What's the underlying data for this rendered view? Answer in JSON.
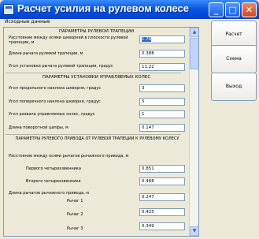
{
  "window": {
    "title": "Расчет усилия на рулевом колесе",
    "controls": {
      "minimize": "_",
      "maximize": "□",
      "close": "✕"
    }
  },
  "menu": {
    "item": "Исходные данные"
  },
  "sections": {
    "s1_title": "ПАРАМЕТРЫ РУЛЕВОЙ ТРАПЕЦИИ",
    "s2_title": "ПАРАМЕТРЫ УСТАНОВКИ УПРАВЛЯЕМЫХ КОЛЕС",
    "s3_title": "ПАРАМЕТРЫ РУЛЕВОГО ПРИВОДА ОТ РУЛЕВОЙ ТРАПЕЦИИ К РУЛЕВОМУ КОЛЕСУ"
  },
  "trapezoid": {
    "kingpin_distance_label": "Расстояние между осями шкворней в плоскости рулевой трапеции, м",
    "kingpin_distance_value": "1.78",
    "lever_length_label": "Длина рычага рулевой трапеции, м",
    "lever_length_value": "0.388",
    "lever_angle_label": "Угол установки рычага рулевой трапеции, градус",
    "lever_angle_value": "11.22"
  },
  "wheels": {
    "longitudinal_tilt_label": "Угол продольного наклона шкворня, градус",
    "longitudinal_tilt_value": "3",
    "transverse_tilt_label": "Угол поперечного наклона шкворня, градус",
    "transverse_tilt_value": "5",
    "camber_label": "Угол развала управляемых колес, градус",
    "camber_value": "1",
    "knuckle_length_label": "Длина поворотной цапфы, м",
    "knuckle_length_value": "0.147"
  },
  "drive": {
    "lever_axes_label": "Расстояние между осями рычагов рычажного привода, м",
    "first_quad_label": "Первого четырехзвенника",
    "first_quad_value": "0.851",
    "second_quad_label": "Второго четырехзвенника",
    "second_quad_value": "0.468",
    "lever_lengths_label": "Длина рычагов рычажного привода, м",
    "lever1_label": "Рычаг 1",
    "lever1_value": "0.247",
    "lever2_label": "Рычаг 2",
    "lever2_value": "0.425",
    "lever3_label": "Рычаг 3",
    "lever3_value": "0.349"
  },
  "buttons": {
    "calculate": "Расчет",
    "scheme": "Схема",
    "exit": "Выход"
  },
  "scrollbar": {
    "up": "▲",
    "down": "▼"
  }
}
